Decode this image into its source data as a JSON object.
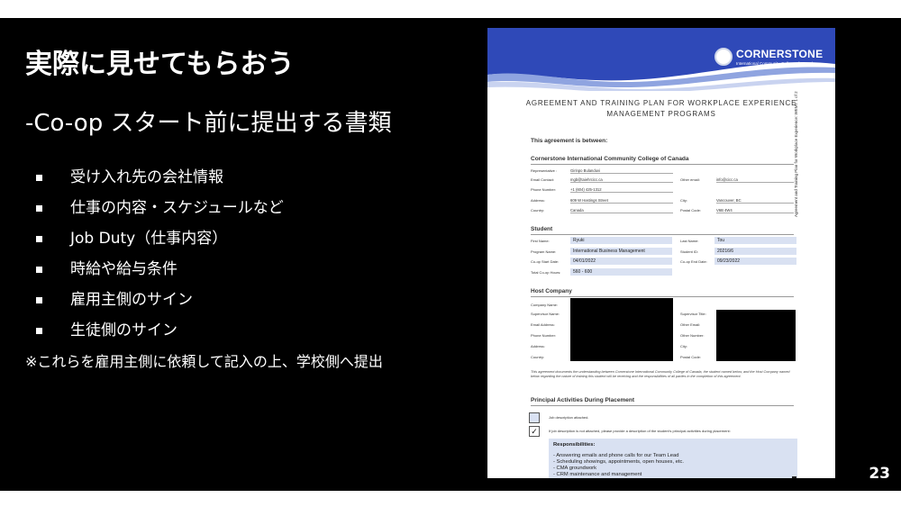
{
  "slide": {
    "title": "実際に見せてもらおう",
    "subtitle": "-Co-op スタート前に提出する書類",
    "bullets": [
      "受け入れ先の会社情報",
      "仕事の内容・スケジュールなど",
      "Job Duty（仕事内容）",
      "時給や給与条件",
      "雇用主側のサイン",
      "生徒側のサイン"
    ],
    "note": "※これらを雇用主側に依頼して記入の上、学校側へ提出",
    "page_number": "23"
  },
  "document": {
    "logo_name": "CORNERSTONE",
    "logo_sub": "International Community College of Canada",
    "title_line1": "AGREEMENT AND TRAINING PLAN FOR WORKPLACE EXPERIENCE",
    "title_line2": "MANAGEMENT PROGRAMS",
    "side_text": "Agreement and Training Plan for Workplace Experience: WEMT 1 of 2",
    "between": "This agreement is between:",
    "college": {
      "heading": "Cornerstone International Community College of Canada",
      "representative_label": "Representative :",
      "representative_value": "Girinpo Bulanduvi",
      "email_label": "Email Contact:",
      "email_value": "mgb@taiehrcicc.ca",
      "other_email_label": "Other email:",
      "other_email_value": "info@cicc.ca",
      "phone_label": "Phone Number:",
      "phone_value": "+1 (604) 425-1312",
      "address_label": "Address:",
      "address_value": "609 W Hastings Street",
      "city_label": "City:",
      "city_value": "Vancouver, BC",
      "country_label": "Country:",
      "country_value": "Canada",
      "postal_label": "Postal Code:",
      "postal_value": "V6B 4W4"
    },
    "student": {
      "heading": "Student",
      "first_name_label": "First Name:",
      "first_name_value": "Ryuki",
      "last_name_label": "Last Name:",
      "last_name_value": "Tou",
      "program_label": "Program Name:",
      "program_value": "International Business Management",
      "student_id_label": "Student ID:",
      "student_id_value": "20216/6",
      "start_label": "Co-op Start Date:",
      "start_value": "04/01/2022",
      "end_label": "Co-op End Date:",
      "end_value": "09/23/2022",
      "hours_label": "Total Co-op Hours:",
      "hours_value": "560 - 600"
    },
    "host": {
      "heading": "Host Company",
      "left_labels": [
        "Company Name:",
        "Supervisor Name:",
        "Email Address:",
        "Phone Number:",
        "Address:",
        "Country:"
      ],
      "right_labels": [
        "Supervisor Title:",
        "Other Email:",
        "Other Number:",
        "City:",
        "Postal Code:"
      ]
    },
    "paragraph": "This agreement documents the understanding between Cornerstone International Community College of Canada, the student named below, and the Host Company named below regarding the nature of training this student will be receiving and the responsibilities of all parties in the completion of this agreement.",
    "principal": {
      "heading": "Principal Activities During Placement",
      "attached_label": "Job description attached.",
      "not_attached_label": "If job description is not attached, please provide a description of the student's principal activities during placement:",
      "check_mark": "✓",
      "resp_title": "Responsibilities:",
      "resp_items": [
        "- Answering emails and phone calls for our Team Lead",
        "- Scheduling showings, appointments, open houses, etc.",
        "- CMA groundwork",
        "- CRM maintenance and management"
      ]
    }
  }
}
